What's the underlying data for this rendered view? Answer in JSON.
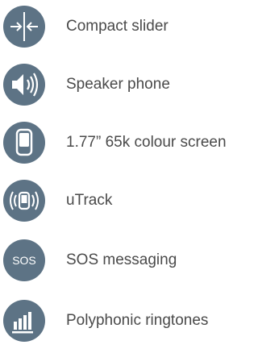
{
  "features": [
    {
      "icon": "compact-slider-icon",
      "label": "Compact slider"
    },
    {
      "icon": "speaker-icon",
      "label": "Speaker phone"
    },
    {
      "icon": "phone-screen-icon",
      "label": "1.77” 65k colour screen"
    },
    {
      "icon": "utrack-icon",
      "label": "uTrack"
    },
    {
      "icon": "sos-icon",
      "label": "SOS messaging",
      "icon_text": "SOS"
    },
    {
      "icon": "ringtone-bars-icon",
      "label": "Polyphonic ringtones"
    }
  ],
  "colors": {
    "icon_background": "#5d7385",
    "icon_foreground": "#ffffff",
    "label_text": "#4a4a4a"
  }
}
